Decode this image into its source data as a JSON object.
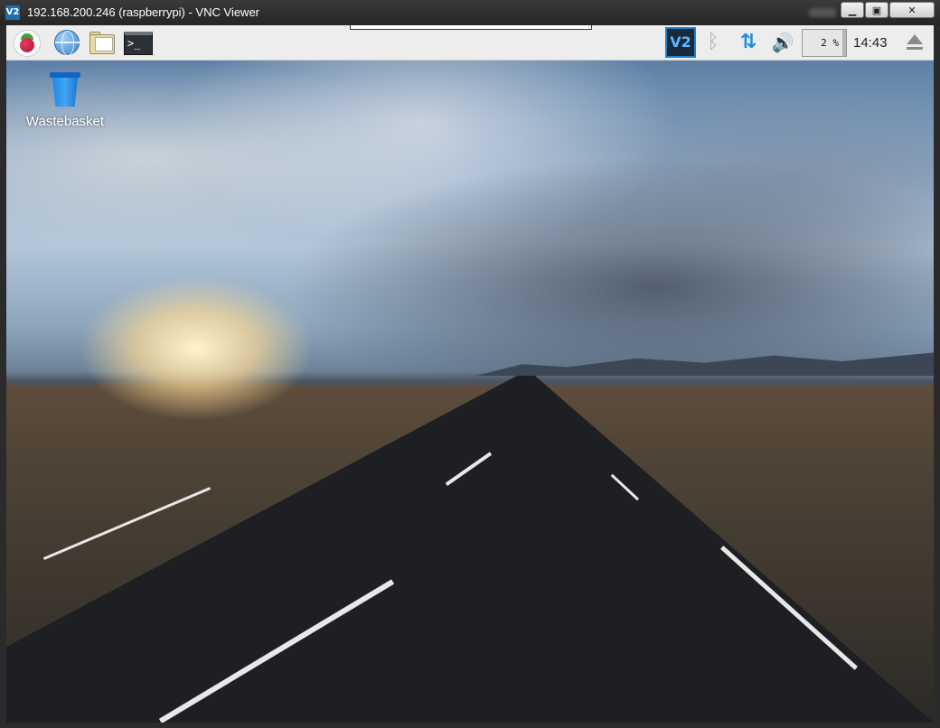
{
  "window": {
    "title": "192.168.200.246 (raspberrypi) - VNC Viewer",
    "icon_label": "V2",
    "controls": {
      "minimize": "▁",
      "maximize": "▣",
      "close": "✕"
    }
  },
  "taskbar": {
    "launchers": [
      {
        "name": "raspberry-menu-icon"
      },
      {
        "name": "web-browser-icon"
      },
      {
        "name": "file-manager-icon"
      },
      {
        "name": "terminal-icon",
        "glyph": ">_"
      }
    ],
    "tray": {
      "vnc_label": "V2",
      "bluetooth_glyph": "ᛒ",
      "network_glyph": "⇅",
      "volume_glyph": "🔊",
      "cpu_usage": "2 %",
      "clock": "14:43",
      "eject": "eject-icon"
    }
  },
  "desktop": {
    "icons": [
      {
        "label": "Wastebasket",
        "icon": "trash-icon"
      }
    ]
  },
  "colors": {
    "panel_bg": "#ededed",
    "accent": "#1f8ee6",
    "bin_blue": "#1e88e5"
  }
}
